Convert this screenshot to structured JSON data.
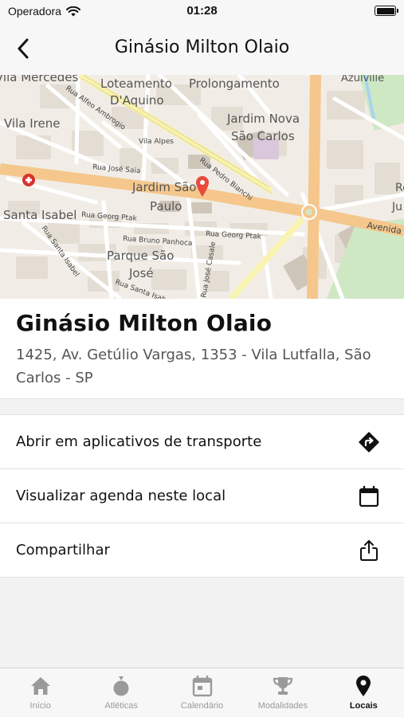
{
  "status_bar": {
    "carrier": "Operadora",
    "time": "01:28"
  },
  "nav": {
    "title": "Ginásio Milton Olaio"
  },
  "map": {
    "labels": {
      "mercedes": "Vila Mercedes",
      "alfeo": "Rua Alfeo Ambrogio",
      "loteamento": "Loteamento",
      "daquino": "D'Aquino",
      "prolongamento": "Prolongamento",
      "azulville": "Azulville",
      "jardim_nova": "Jardim Nova",
      "sao_carlos": "São Carlos",
      "vila_irene": "Vila Irene",
      "vila_alpes": "Vila Alpes",
      "jose_saia": "Rua José Saia",
      "pedro_bianchi": "Rua Pedro Bianchi",
      "jardim_sao": "Jardim São",
      "paulo": "Paulo",
      "santa_isabel": "Santa Isabel",
      "georg_ptak_1": "Rua Georg Ptak",
      "georg_ptak_2": "Rua Georg Ptak",
      "bruno_panhoca": "Rua Bruno Panhoca",
      "parque_sao": "Parque São",
      "jose": "José",
      "santa_isabel_rua": "Rua Santa Isabel",
      "jose_casale": "Rua José Casale",
      "avenida": "Avenida",
      "re": "Re",
      "ju": "Ju"
    },
    "colors": {
      "main_road": "#f5c78c",
      "secondary_road": "#f8f3b0",
      "park": "#cfe8c4",
      "pin": "#e84a3c"
    }
  },
  "place": {
    "name": "Ginásio Milton Olaio",
    "address": "1425, Av. Getúlio Vargas, 1353 - Vila Lutfalla, São Carlos - SP"
  },
  "actions": [
    {
      "label": "Abrir em aplicativos de transporte",
      "icon": "directions-icon"
    },
    {
      "label": "Visualizar agenda neste local",
      "icon": "calendar-icon"
    },
    {
      "label": "Compartilhar",
      "icon": "share-icon"
    }
  ],
  "tabs": [
    {
      "label": "Início",
      "icon": "home-icon",
      "active": false
    },
    {
      "label": "Atléticas",
      "icon": "medal-icon",
      "active": false
    },
    {
      "label": "Calendário",
      "icon": "calendar-icon",
      "active": false
    },
    {
      "label": "Modalidades",
      "icon": "trophy-icon",
      "active": false
    },
    {
      "label": "Locais",
      "icon": "location-pin-icon",
      "active": true
    }
  ]
}
